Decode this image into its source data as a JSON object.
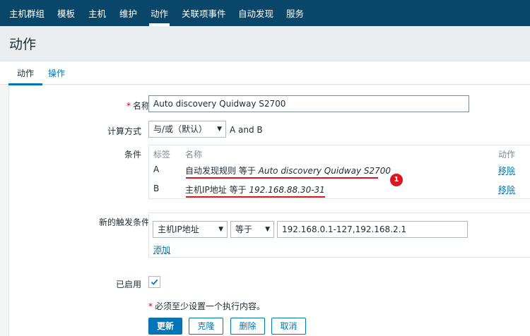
{
  "nav": {
    "items": [
      "主机群组",
      "模板",
      "主机",
      "维护",
      "动作",
      "关联项事件",
      "自动发现",
      "服务"
    ],
    "active": "动作"
  },
  "page": {
    "title": "动作"
  },
  "tabs": [
    {
      "label": "动作",
      "active": true
    },
    {
      "label": "操作",
      "active": false
    }
  ],
  "form": {
    "required_mark": "*",
    "name_label": "名称",
    "name_value": "Auto discovery Quidway S2700",
    "calc_label": "计算方式",
    "calc_value": "与/或（默认）",
    "calc_expression": "A and B",
    "conditions_label": "条件",
    "conditions_header": {
      "label": "标签",
      "name": "名称",
      "action": "动作"
    },
    "conditions": [
      {
        "label": "A",
        "name_prefix": "自动发现规则 等于 ",
        "name_value": "Auto discovery Quidway S2700",
        "action": "移除"
      },
      {
        "label": "B",
        "name_prefix": "主机IP地址 等于 ",
        "name_value": "192.168.88.30-31",
        "action": "移除"
      }
    ],
    "annotation_number": "1",
    "new_condition_label": "新的触发条件",
    "new_condition_type": "主机IP地址",
    "new_condition_operator": "等于",
    "new_condition_value": "192.168.0.1-127,192.168.2.1",
    "add_link": "添加",
    "enabled_label": "已启用",
    "enabled": true,
    "warning": "必须至少设置一个执行内容。"
  },
  "buttons": {
    "update": "更新",
    "clone": "克隆",
    "delete": "删除",
    "cancel": "取消"
  },
  "colors": {
    "nav_bg": "#0a466a",
    "accent": "#0275b8",
    "annotation": "#e0141e"
  }
}
